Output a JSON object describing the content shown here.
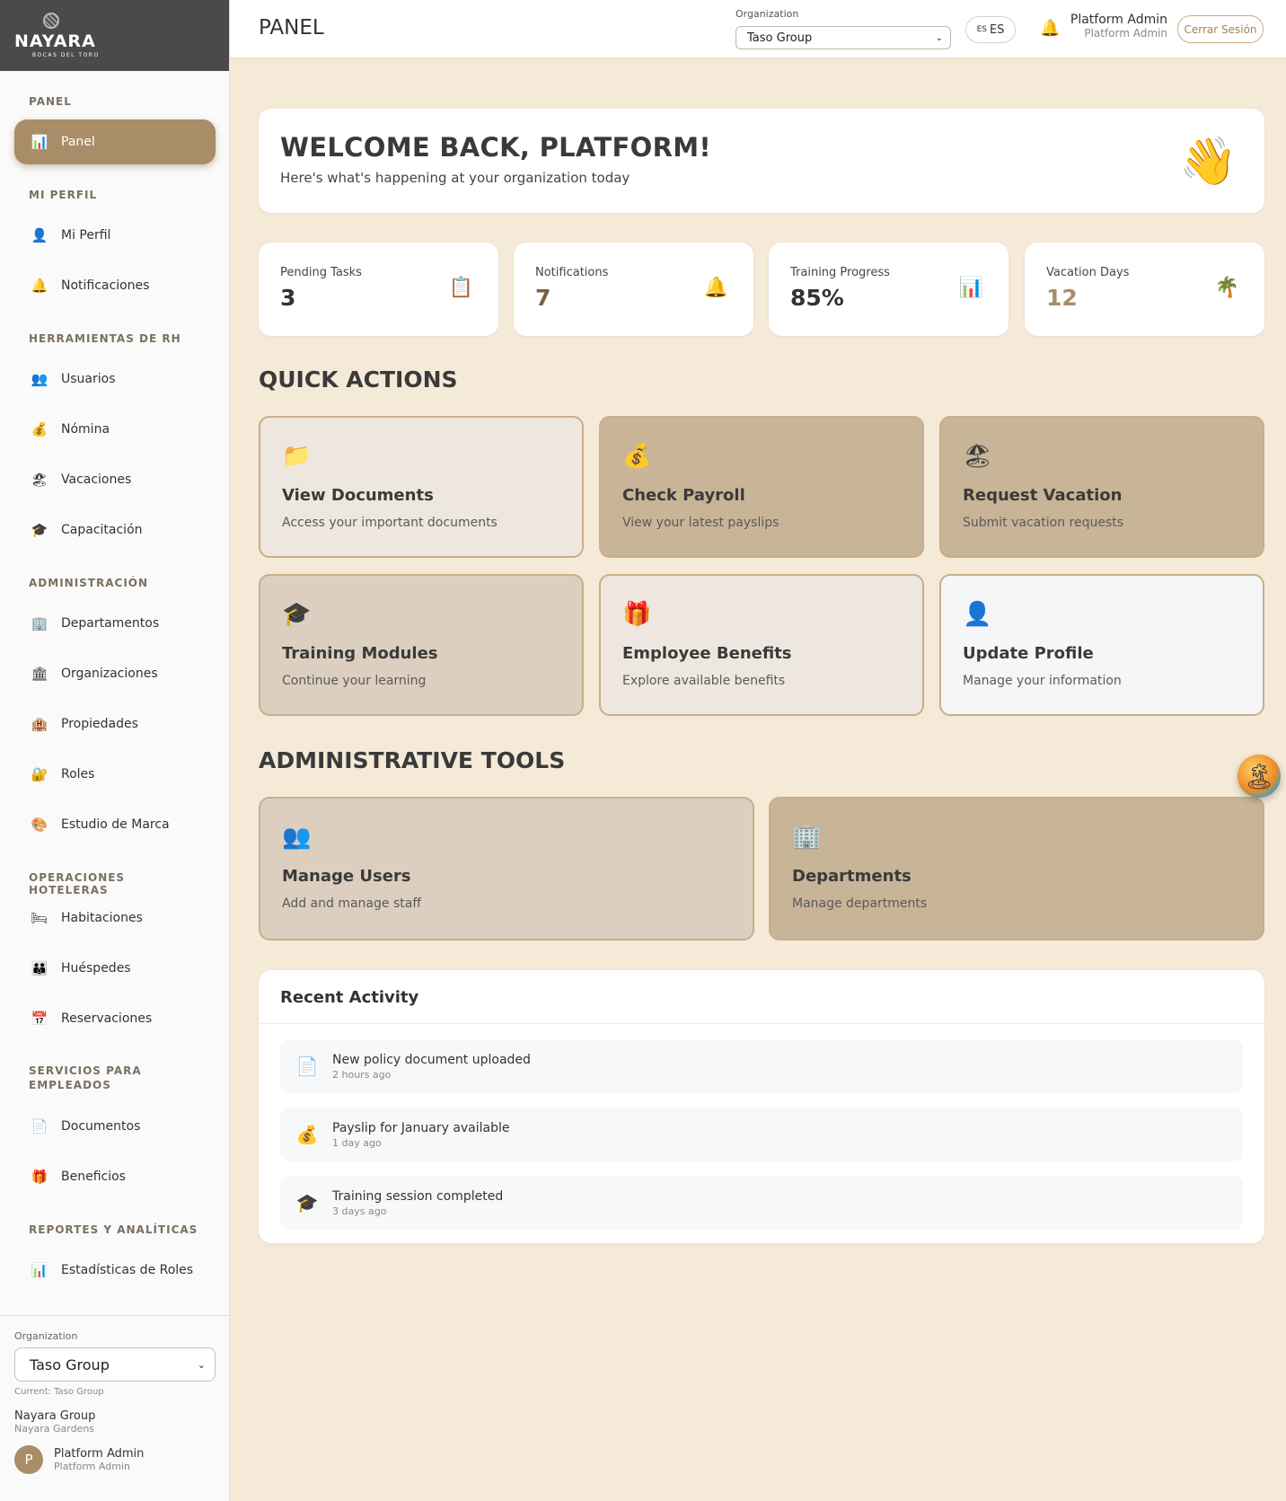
{
  "brand": {
    "name": "NAYARA",
    "tagline": "BOCAS DEL TORO"
  },
  "sidebar": {
    "sections": [
      {
        "title": "PANEL",
        "items": [
          {
            "label": "Panel",
            "icon": "chart-icon",
            "glyph": "📊",
            "active": true
          }
        ]
      },
      {
        "title": "MI PERFIL",
        "items": [
          {
            "label": "Mi Perfil",
            "icon": "user-icon",
            "glyph": "👤"
          },
          {
            "label": "Notificaciones",
            "icon": "bell-icon",
            "glyph": "🔔"
          }
        ]
      },
      {
        "title": "HERRAMIENTAS DE RH",
        "items": [
          {
            "label": "Usuarios",
            "icon": "users-icon",
            "glyph": "👥"
          },
          {
            "label": "Nómina",
            "icon": "money-bag-icon",
            "glyph": "💰"
          },
          {
            "label": "Vacaciones",
            "icon": "beach-icon",
            "glyph": "🏖"
          },
          {
            "label": "Capacitación",
            "icon": "graduation-cap-icon",
            "glyph": "🎓"
          }
        ]
      },
      {
        "title": "ADMINISTRACIÓN",
        "items": [
          {
            "label": "Departamentos",
            "icon": "office-building-icon",
            "glyph": "🏢"
          },
          {
            "label": "Organizaciones",
            "icon": "classical-building-icon",
            "glyph": "🏛"
          },
          {
            "label": "Propiedades",
            "icon": "hotel-icon",
            "glyph": "🏨"
          },
          {
            "label": "Roles",
            "icon": "lock-icon",
            "glyph": "🔐"
          },
          {
            "label": "Estudio de Marca",
            "icon": "palette-icon",
            "glyph": "🎨"
          }
        ]
      },
      {
        "title": "OPERACIONES HOTELERAS",
        "items": [
          {
            "label": "Habitaciones",
            "icon": "bed-icon",
            "glyph": "🛏"
          },
          {
            "label": "Huéspedes",
            "icon": "family-icon",
            "glyph": "👪"
          },
          {
            "label": "Reservaciones",
            "icon": "calendar-icon",
            "glyph": "📅"
          }
        ]
      },
      {
        "title_line1": "SERVICIOS PARA",
        "title_line2": "EMPLEADOS",
        "items": [
          {
            "label": "Documentos",
            "icon": "document-icon",
            "glyph": "📄"
          },
          {
            "label": "Beneficios",
            "icon": "gift-icon",
            "glyph": "🎁"
          }
        ]
      },
      {
        "title": "REPORTES Y ANALÍTICAS",
        "items": [
          {
            "label": "Estadísticas de Roles",
            "icon": "chart-icon",
            "glyph": "📊"
          }
        ]
      }
    ],
    "footer": {
      "org_label": "Organization",
      "org_value": "Taso Group",
      "current": "Current: Taso Group",
      "group": "Nayara Group",
      "property": "Nayara Gardens",
      "avatar_letter": "P",
      "user_name": "Platform Admin",
      "user_role": "Platform Admin"
    }
  },
  "header": {
    "title": "PANEL",
    "org_label": "Organization",
    "org_value": "Taso Group",
    "lang_flag": "ES",
    "lang_code": "ES",
    "user_name": "Platform Admin",
    "user_role": "Platform Admin",
    "logout": "Cerrar Sesión"
  },
  "welcome": {
    "title": "WELCOME BACK, PLATFORM!",
    "subtitle": "Here's what's happening at your organization today",
    "glyph": "👋"
  },
  "stats": [
    {
      "label": "Pending Tasks",
      "value": "3",
      "icon": "clipboard-icon",
      "glyph": "📋"
    },
    {
      "label": "Notifications",
      "value": "7",
      "icon": "bell-icon",
      "glyph": "🔔"
    },
    {
      "label": "Training Progress",
      "value": "85%",
      "icon": "chart-icon",
      "glyph": "📊"
    },
    {
      "label": "Vacation Days",
      "value": "12",
      "icon": "palm-tree-icon",
      "glyph": "🌴"
    }
  ],
  "quick_actions": {
    "title": "QUICK ACTIONS",
    "items": [
      {
        "title": "View Documents",
        "desc": "Access your important documents",
        "icon": "folder-icon",
        "glyph": "📁"
      },
      {
        "title": "Check Payroll",
        "desc": "View your latest payslips",
        "icon": "money-bag-icon",
        "glyph": "💰"
      },
      {
        "title": "Request Vacation",
        "desc": "Submit vacation requests",
        "icon": "beach-icon",
        "glyph": "🏖"
      },
      {
        "title": "Training Modules",
        "desc": "Continue your learning",
        "icon": "graduation-cap-icon",
        "glyph": "🎓"
      },
      {
        "title": "Employee Benefits",
        "desc": "Explore available benefits",
        "icon": "gift-icon",
        "glyph": "🎁"
      },
      {
        "title": "Update Profile",
        "desc": "Manage your information",
        "icon": "user-icon",
        "glyph": "👤"
      }
    ]
  },
  "admin_tools": {
    "title": "ADMINISTRATIVE TOOLS",
    "items": [
      {
        "title": "Manage Users",
        "desc": "Add and manage staff",
        "icon": "users-icon",
        "glyph": "👥"
      },
      {
        "title": "Departments",
        "desc": "Manage departments",
        "icon": "office-building-icon",
        "glyph": "🏢"
      }
    ]
  },
  "activity": {
    "title": "Recent Activity",
    "items": [
      {
        "text": "New policy document uploaded",
        "time": "2 hours ago",
        "icon": "document-icon",
        "glyph": "📄"
      },
      {
        "text": "Payslip for January available",
        "time": "1 day ago",
        "icon": "money-bag-icon",
        "glyph": "💰"
      },
      {
        "text": "Training session completed",
        "time": "3 days ago",
        "icon": "graduation-cap-icon",
        "glyph": "🎓"
      }
    ]
  },
  "floating_button": {
    "icon": "sunset-island-icon",
    "glyph": "🏝"
  },
  "colors": {
    "accent": "#a88d68",
    "page_bg": "#f5ead8",
    "sidebar_logo_bg": "#4a4a4a"
  }
}
